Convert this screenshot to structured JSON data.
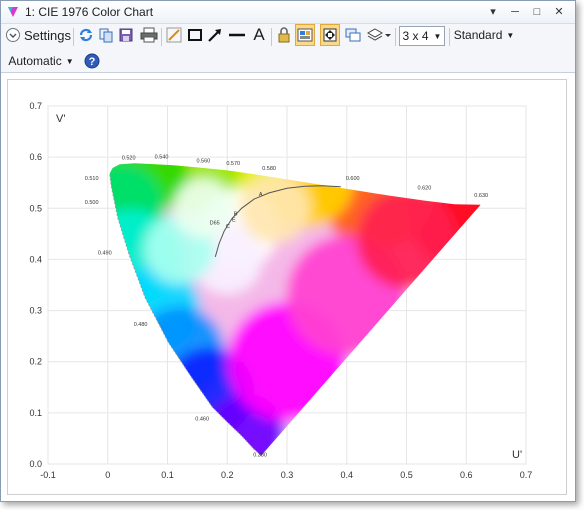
{
  "window": {
    "title": "1: CIE 1976 Color Chart",
    "controls": [
      "─",
      "□",
      "✕"
    ],
    "pin_glyph": "▾"
  },
  "toolbar": {
    "settings_label": "Settings",
    "layout_value": "3 x 4",
    "style_value": "Standard",
    "scale_value": "Automatic",
    "help_glyph": "?",
    "text_tool_glyph": "A"
  },
  "chart_data": {
    "type": "scatter",
    "xlabel": "U'",
    "ylabel": "V'",
    "xlim": [
      -0.1,
      0.7
    ],
    "ylim": [
      0.0,
      0.7
    ],
    "x_ticks": [
      "-0.1",
      "0",
      "0.1",
      "0.2",
      "0.3",
      "0.4",
      "0.5",
      "0.6",
      "0.7"
    ],
    "y_ticks": [
      "0.0",
      "0.1",
      "0.2",
      "0.3",
      "0.4",
      "0.5",
      "0.6",
      "0.7"
    ],
    "grid": true,
    "wavelength_labels": [
      {
        "text": "0.380",
        "u": 0.255,
        "v": 0.015
      },
      {
        "text": "0.460",
        "u": 0.158,
        "v": 0.085
      },
      {
        "text": "0.480",
        "u": 0.055,
        "v": 0.27
      },
      {
        "text": "0.490",
        "u": -0.005,
        "v": 0.41
      },
      {
        "text": "0.500",
        "u": -0.027,
        "v": 0.508
      },
      {
        "text": "0.510",
        "u": -0.027,
        "v": 0.555
      },
      {
        "text": "0.520",
        "u": 0.035,
        "v": 0.595
      },
      {
        "text": "0.540",
        "u": 0.09,
        "v": 0.597
      },
      {
        "text": "0.560",
        "u": 0.16,
        "v": 0.59
      },
      {
        "text": "0.570",
        "u": 0.21,
        "v": 0.585
      },
      {
        "text": "0.580",
        "u": 0.27,
        "v": 0.575
      },
      {
        "text": "0.600",
        "u": 0.41,
        "v": 0.555
      },
      {
        "text": "0.620",
        "u": 0.53,
        "v": 0.537
      },
      {
        "text": "0.630",
        "u": 0.625,
        "v": 0.522
      }
    ],
    "white_points": [
      {
        "text": "A",
        "u": 0.256,
        "v": 0.524
      },
      {
        "text": "B",
        "u": 0.214,
        "v": 0.486
      },
      {
        "text": "D65",
        "u": 0.179,
        "v": 0.468
      },
      {
        "text": "E",
        "u": 0.211,
        "v": 0.474
      },
      {
        "text": "C",
        "u": 0.201,
        "v": 0.461
      }
    ],
    "locus": [
      [
        0.2568,
        0.0165
      ],
      [
        0.2444,
        0.0294
      ],
      [
        0.2236,
        0.0556
      ],
      [
        0.1996,
        0.0825
      ],
      [
        0.1752,
        0.1111
      ],
      [
        0.1407,
        0.1688
      ],
      [
        0.1012,
        0.2384
      ],
      [
        0.0627,
        0.3249
      ],
      [
        0.0356,
        0.41
      ],
      [
        0.0169,
        0.4812
      ],
      [
        0.0058,
        0.544
      ],
      [
        0.0033,
        0.5682
      ],
      [
        0.0082,
        0.5788
      ],
      [
        0.02,
        0.586
      ],
      [
        0.045,
        0.588
      ],
      [
        0.075,
        0.5863
      ],
      [
        0.11,
        0.5841
      ],
      [
        0.15,
        0.58
      ],
      [
        0.2,
        0.574
      ],
      [
        0.26,
        0.564
      ],
      [
        0.33,
        0.551
      ],
      [
        0.4,
        0.538
      ],
      [
        0.47,
        0.525
      ],
      [
        0.53,
        0.515
      ],
      [
        0.58,
        0.508
      ],
      [
        0.624,
        0.507
      ]
    ],
    "planckian": [
      [
        0.18,
        0.405
      ],
      [
        0.186,
        0.43
      ],
      [
        0.195,
        0.456
      ],
      [
        0.208,
        0.48
      ],
      [
        0.224,
        0.5
      ],
      [
        0.245,
        0.518
      ],
      [
        0.27,
        0.53
      ],
      [
        0.3,
        0.539
      ],
      [
        0.33,
        0.543
      ],
      [
        0.36,
        0.544
      ],
      [
        0.39,
        0.542
      ]
    ]
  }
}
